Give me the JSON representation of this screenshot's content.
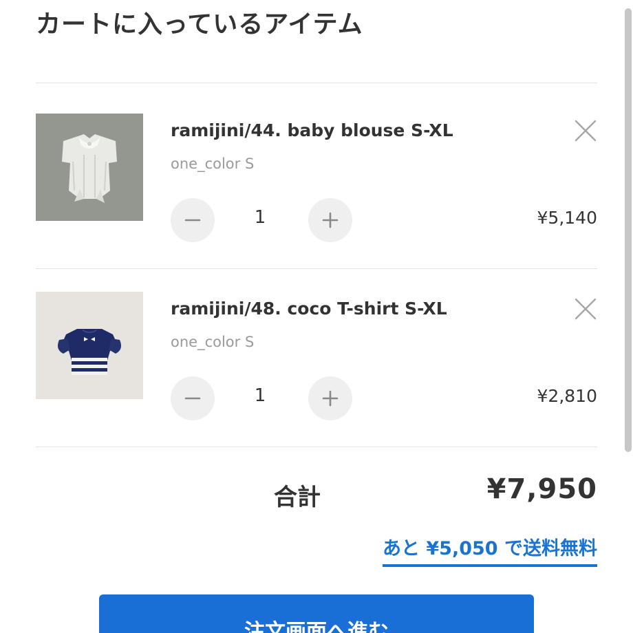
{
  "cart": {
    "title": "カートに入っているアイテム",
    "items": [
      {
        "name": "ramijini/44. baby blouse S-XL",
        "variant": "one_color S",
        "quantity": "1",
        "price": "¥5,140",
        "image": "white-baby-blouse-photo",
        "minus_symbol": "−",
        "plus_symbol": "+"
      },
      {
        "name": "ramijini/48. coco T-shirt S-XL",
        "variant": "one_color S",
        "quantity": "1",
        "price": "¥2,810",
        "image": "navy-striped-tshirt-photo",
        "minus_symbol": "−",
        "plus_symbol": "+"
      }
    ]
  },
  "summary": {
    "total_label": "合計",
    "total_amount": "¥7,950",
    "shipping_note": "あと ¥5,050 で送料無料"
  },
  "checkout": {
    "label": "注文画面へ進む"
  },
  "colors": {
    "accent": "#1a74cf",
    "button": "#1a6fd6",
    "text": "#333333",
    "muted": "#9a9a9a",
    "qty_bg": "#efefef"
  }
}
